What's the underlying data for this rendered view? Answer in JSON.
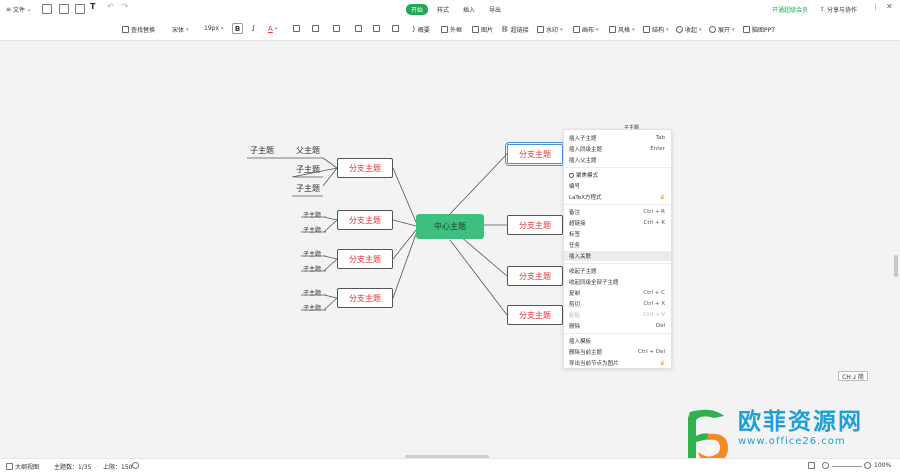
{
  "topbar": {
    "file_label": "文件",
    "tabs": [
      {
        "label": "开始",
        "active": true
      },
      {
        "label": "样式",
        "active": false
      },
      {
        "label": "插入",
        "active": false
      },
      {
        "label": "导出",
        "active": false
      }
    ],
    "upgrade_label": "开通超级会员",
    "share_label": "分享与协作",
    "more_icon": "more-icon",
    "close_icon": "close-icon"
  },
  "toolbar": {
    "find_replace": "查找替换",
    "font_family": "宋体",
    "font_size": "19px",
    "bold": "B",
    "italic": "I",
    "font_color": "A",
    "summary": "概要",
    "frame": "外框",
    "image": "图片",
    "hyperlink": "超链接",
    "watermark": "水印",
    "layout": "画布",
    "style": "风格",
    "structure": "结构",
    "collapse": "收起",
    "expand": "展开",
    "ppt": "脑图PPT"
  },
  "map": {
    "center": "中心主题",
    "branches": [
      "分支主题",
      "分支主题",
      "分支主题",
      "分支主题",
      "分支主题",
      "分支主题",
      "分支主题",
      "分支主题"
    ],
    "leaf_father": "父主题",
    "leaf_sub": "子主题",
    "floating_label": "子主题",
    "accent_color": "#3dbf7e",
    "branch_text_color": "#e03535"
  },
  "context_menu": {
    "items": [
      {
        "label": "插入子主题",
        "key": "Tab"
      },
      {
        "label": "插入同级主题",
        "key": "Enter"
      },
      {
        "label": "插入父主题",
        "key": ""
      },
      {
        "label": "聚焦模式",
        "key": ""
      },
      {
        "label": "编号",
        "key": ""
      },
      {
        "label": "LaTeX方程式",
        "key": "",
        "vip": true
      },
      {
        "label": "备注",
        "key": "Ctrl + R"
      },
      {
        "label": "超链接",
        "key": "Ctrl + K"
      },
      {
        "label": "标签",
        "key": ""
      },
      {
        "label": "任务",
        "key": ""
      },
      {
        "label": "插入关联",
        "key": ""
      },
      {
        "label": "收起子主题",
        "key": ""
      },
      {
        "label": "收起同级全部子主题",
        "key": ""
      },
      {
        "label": "复制",
        "key": "Ctrl + C"
      },
      {
        "label": "剪切",
        "key": "Ctrl + X"
      },
      {
        "label": "粘贴",
        "key": "Ctrl + V",
        "disabled": true
      },
      {
        "label": "删除",
        "key": "Del"
      },
      {
        "label": "插入模板",
        "key": ""
      },
      {
        "label": "删除当前主题",
        "key": "Ctrl + Del"
      },
      {
        "label": "导出当前节点为图片",
        "key": "",
        "vip": true
      }
    ]
  },
  "status": {
    "outline": "大纲视图",
    "topic_count": "主题数：1/35",
    "limit": "上限：150",
    "ime": "CH ⅃ 简",
    "zoom": "100%"
  },
  "watermark": {
    "title": "欧菲资源网",
    "url": "www.office26.com"
  }
}
